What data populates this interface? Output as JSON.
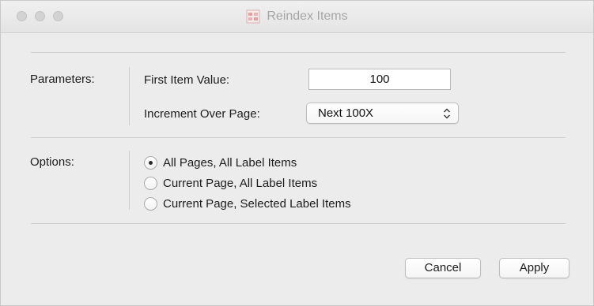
{
  "window": {
    "title": "Reindex Items"
  },
  "parameters": {
    "section_label": "Parameters:",
    "first_item_label": "First Item Value:",
    "first_item_value": "100",
    "increment_label": "Increment Over Page:",
    "increment_selected": "Next 100X"
  },
  "options": {
    "section_label": "Options:",
    "choices": [
      {
        "label": "All Pages, All Label Items",
        "checked": true
      },
      {
        "label": "Current Page, All Label Items",
        "checked": false
      },
      {
        "label": "Current Page, Selected Label Items",
        "checked": false
      }
    ]
  },
  "buttons": {
    "cancel_label": "Cancel",
    "apply_label": "Apply"
  },
  "icons": {
    "window_icon": "reindex-app-icon",
    "popup_indicator": "up-down-chevron-icon"
  },
  "colors": {
    "window_bg": "#ececec",
    "title_text": "#a6a6a6"
  }
}
